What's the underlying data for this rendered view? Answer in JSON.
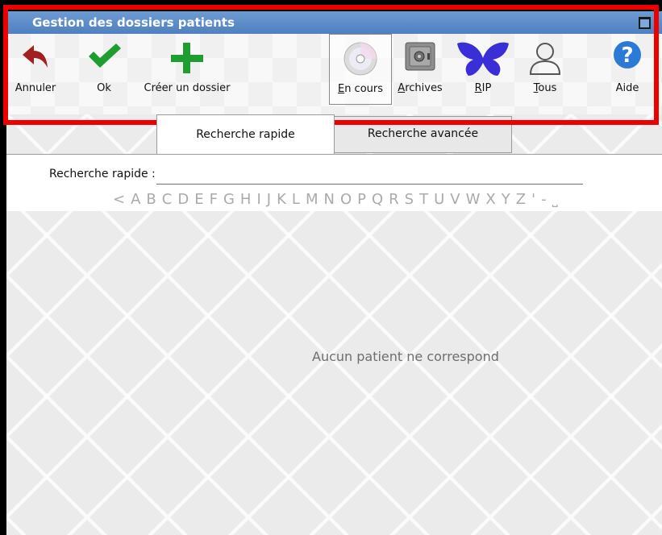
{
  "window": {
    "title": "Gestion des dossiers patients"
  },
  "toolbar": {
    "annuler": "Annuler",
    "ok": "Ok",
    "creer": "Créer un dossier",
    "en_cours": "En cours",
    "archives": "Archives",
    "rip": "RIP",
    "tous": "Tous",
    "aide": "Aide"
  },
  "tabs": {
    "rapide": "Recherche rapide",
    "avancee": "Recherche avancée"
  },
  "search": {
    "label": "Recherche rapide :",
    "value": ""
  },
  "alphabet": [
    "<",
    "A",
    "B",
    "C",
    "D",
    "E",
    "F",
    "G",
    "H",
    "I",
    "J",
    "K",
    "L",
    "M",
    "N",
    "O",
    "P",
    "Q",
    "R",
    "S",
    "T",
    "U",
    "V",
    "W",
    "X",
    "Y",
    "Z",
    "'",
    "-",
    "˽"
  ],
  "results": {
    "empty_message": "Aucun patient ne correspond"
  },
  "colors": {
    "title_bar": "#5b8ccc",
    "highlight_border": "#ee0000",
    "ok_green": "#1e9e2e",
    "annuler_red": "#a32020",
    "rip_purple": "#3a2fd6",
    "aide_blue": "#2a7ad6"
  }
}
